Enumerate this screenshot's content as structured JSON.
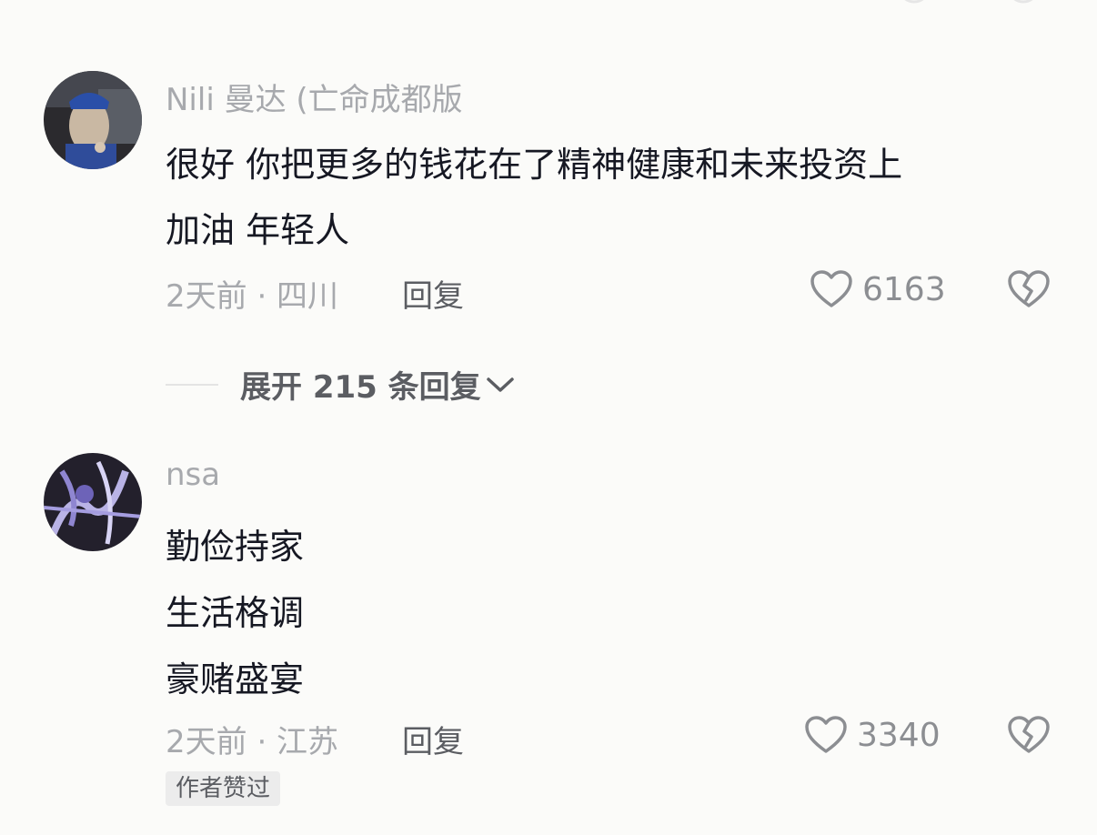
{
  "comments": [
    {
      "username": "Nili 曼达 (亡命成都版",
      "lines": [
        "很好 你把更多的钱花在了精神健康和未来投资上",
        "加油 年轻人"
      ],
      "meta": "2天前 · 四川",
      "reply_label": "回复",
      "likes": "6163",
      "avatar_icon": "avatar-photo-girl-blue-cap"
    },
    {
      "username": "nsa",
      "lines": [
        "勤俭持家",
        "生活格调",
        "豪赌盛宴"
      ],
      "meta": "2天前 · 江苏",
      "reply_label": "回复",
      "likes": "3340",
      "badge": "作者赞过",
      "avatar_icon": "avatar-abstract-purple"
    }
  ],
  "expand_replies": "展开 215 条回复",
  "colors": {
    "background": "#fbfbf9",
    "text": "#161823",
    "muted": "#a7a9ad",
    "secondary": "#5b5d62"
  }
}
